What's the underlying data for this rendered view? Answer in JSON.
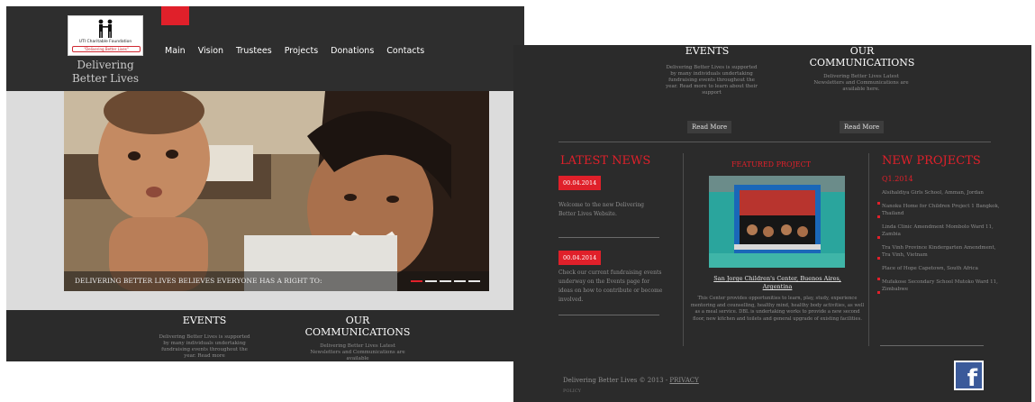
{
  "site": {
    "logo_org": "UTI Charitable Foundation",
    "logo_motto": "\"Delivering Better Lives\"",
    "tagline_line1": "Delivering",
    "tagline_line2": "Better Lives"
  },
  "nav": {
    "items": [
      "Main",
      "Vision",
      "Trustees",
      "Projects",
      "Donations",
      "Contacts"
    ]
  },
  "slider": {
    "caption": "DELIVERING BETTER LIVES BELIEVES EVERYONE HAS A RIGHT TO:",
    "slide_count": 5,
    "active_slide": 1
  },
  "sections": {
    "events_title": "EVENTS",
    "events_text": "Delivering Better Lives is supported by many individuals undertaking fundraising events throughout the year. Read more to learn about their support",
    "events_text_left": "Delivering Better Lives is supported by many individuals undertaking fundraising events throughout the year. Read more",
    "comms_title_line1": "OUR",
    "comms_title_line2": "COMMUNICATIONS",
    "comms_text": "Delivering Better Lives Latest Newsletters and Communications are available here.",
    "comms_text_left": "Delivering Better Lives Latest Newsletters and Communications are available",
    "read_more": "Read More"
  },
  "latest_news": {
    "title": "LATEST NEWS",
    "items": [
      {
        "date": "00.04.2014",
        "text": "Welcome to the new Delivering Better Lives Website."
      },
      {
        "date": "00.04.2014",
        "text": "Check our current fundraising events underway on the Events page for ideas on how to contribute or become involved."
      }
    ]
  },
  "featured": {
    "title": "FEATURED PROJECT",
    "link_line1": "San Jorge Children's Center, Buenos Aires,",
    "link_line2": "Argentina",
    "description": "This Center provides opportunities to learn, play, study, experience mentoring and counselling, healthy mind, healthy body activities, as well as a meal service. DBL is undertaking works to provide a new second floor, new kitchen and toilets and general upgrade of existing facilities."
  },
  "new_projects": {
    "title": "NEW PROJECTS",
    "period": "Q1.2014",
    "items": [
      "Alsihaldiya Girls School, Amman, Jordan",
      "Nanoku Home for Children Project 1 Bangkok, Thailand",
      "Linda Clinic Amendment Mombolo Ward 11, Zambia",
      "Tra Vinh Province Kindergarten Amendment, Tra Vinh, Vietnam",
      "Place of Hope Capetown, South Africa",
      "Mufakose Secondary School Mutoko Ward 11, Zimbabwe"
    ]
  },
  "footer": {
    "copyright": "Delivering Better Lives © 2013 -",
    "privacy": "PRIVACY",
    "sub": "POLICY"
  },
  "colors": {
    "accent": "#e0202a",
    "background": "#2b2b2b",
    "text_muted": "#8e8e8e",
    "facebook": "#3b5a9a"
  },
  "icons": {
    "logo": "two-people-holding-hands-icon",
    "social": "facebook-icon"
  }
}
